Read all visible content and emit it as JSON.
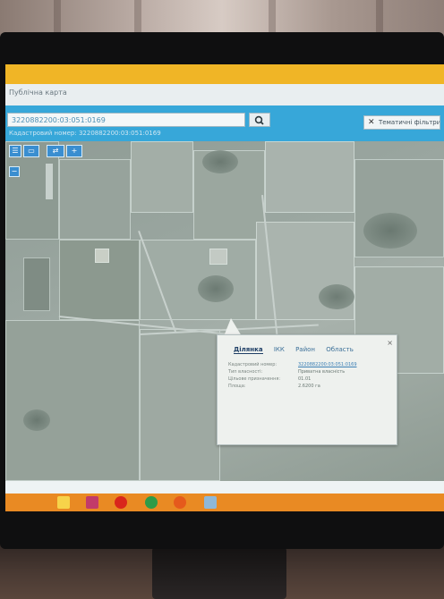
{
  "window": {
    "title": "Публічна карта"
  },
  "search": {
    "value": "3220882200:03:051:0169",
    "sublabel": "Кадастровий номер: 3220882200:03:051:0169"
  },
  "toolbar": {
    "tools_label": "Тематичні фільтри"
  },
  "map_controls": [
    "☰",
    "▭",
    "⇄",
    "+",
    "−"
  ],
  "popup": {
    "tabs": [
      "Ділянка",
      "ІКК",
      "Район",
      "Область"
    ],
    "active_tab": "Ділянка",
    "close": "×",
    "rows": [
      {
        "key": "Кадастровий номер:",
        "value": "3220882200:03:051:0169"
      },
      {
        "key": "Тип власності:",
        "value": "Приватна власність"
      },
      {
        "key": "Цільове призначення:",
        "value": "01.01"
      },
      {
        "key": "Площа:",
        "value": "2.6200 га"
      }
    ]
  },
  "taskbar": {
    "icons": [
      "folder-icon",
      "media-icon",
      "opera-icon",
      "chrome-icon",
      "firefox-icon",
      "network-icon"
    ],
    "colors": {
      "bar": "#e98a23",
      "folder": "#f7d34a",
      "media": "#c23b6a",
      "opera": "#d9261c",
      "chrome": "#2e9b48",
      "firefox": "#e55a1c",
      "network": "#8fb8d8"
    }
  },
  "colors": {
    "header": "#f0b526",
    "search_bar": "#37a7d9",
    "map_control": "#3a8ed0"
  }
}
